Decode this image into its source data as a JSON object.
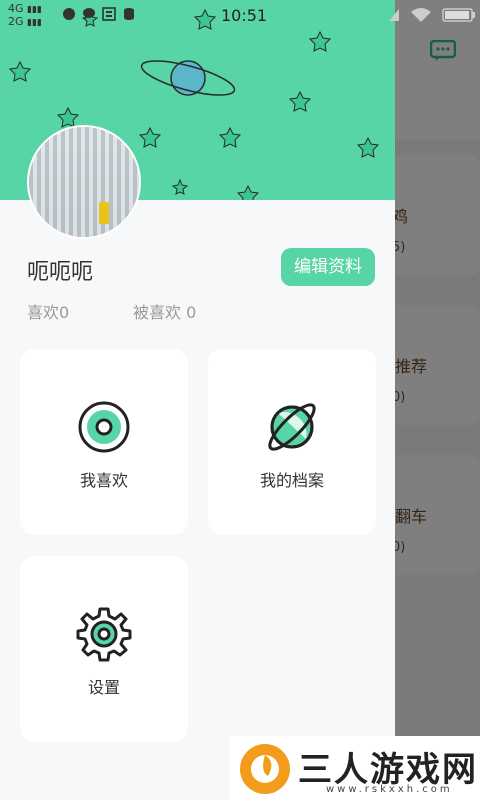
{
  "status_bar": {
    "network_top": "4G",
    "network_bottom": "2G",
    "time": "10:51"
  },
  "background": {
    "items": [
      {
        "title": "鸡",
        "sub": "5)"
      },
      {
        "title": "推荐",
        "sub": "0)"
      },
      {
        "title": "翻车",
        "sub": "0)"
      }
    ]
  },
  "drawer": {
    "username": "呃呃呃",
    "edit_label": "编辑资料",
    "likes_label": "喜欢0",
    "liked_label": "被喜欢 0",
    "cards": [
      {
        "label": "我喜欢",
        "icon": "disc-icon"
      },
      {
        "label": "我的档案",
        "icon": "planet-icon"
      },
      {
        "label": "设置",
        "icon": "gear-icon"
      }
    ]
  },
  "watermark": {
    "text": "三人游戏网",
    "sub": "www.rskxxh.com"
  },
  "colors": {
    "accent": "#57d5a6",
    "dark": "#222222"
  }
}
